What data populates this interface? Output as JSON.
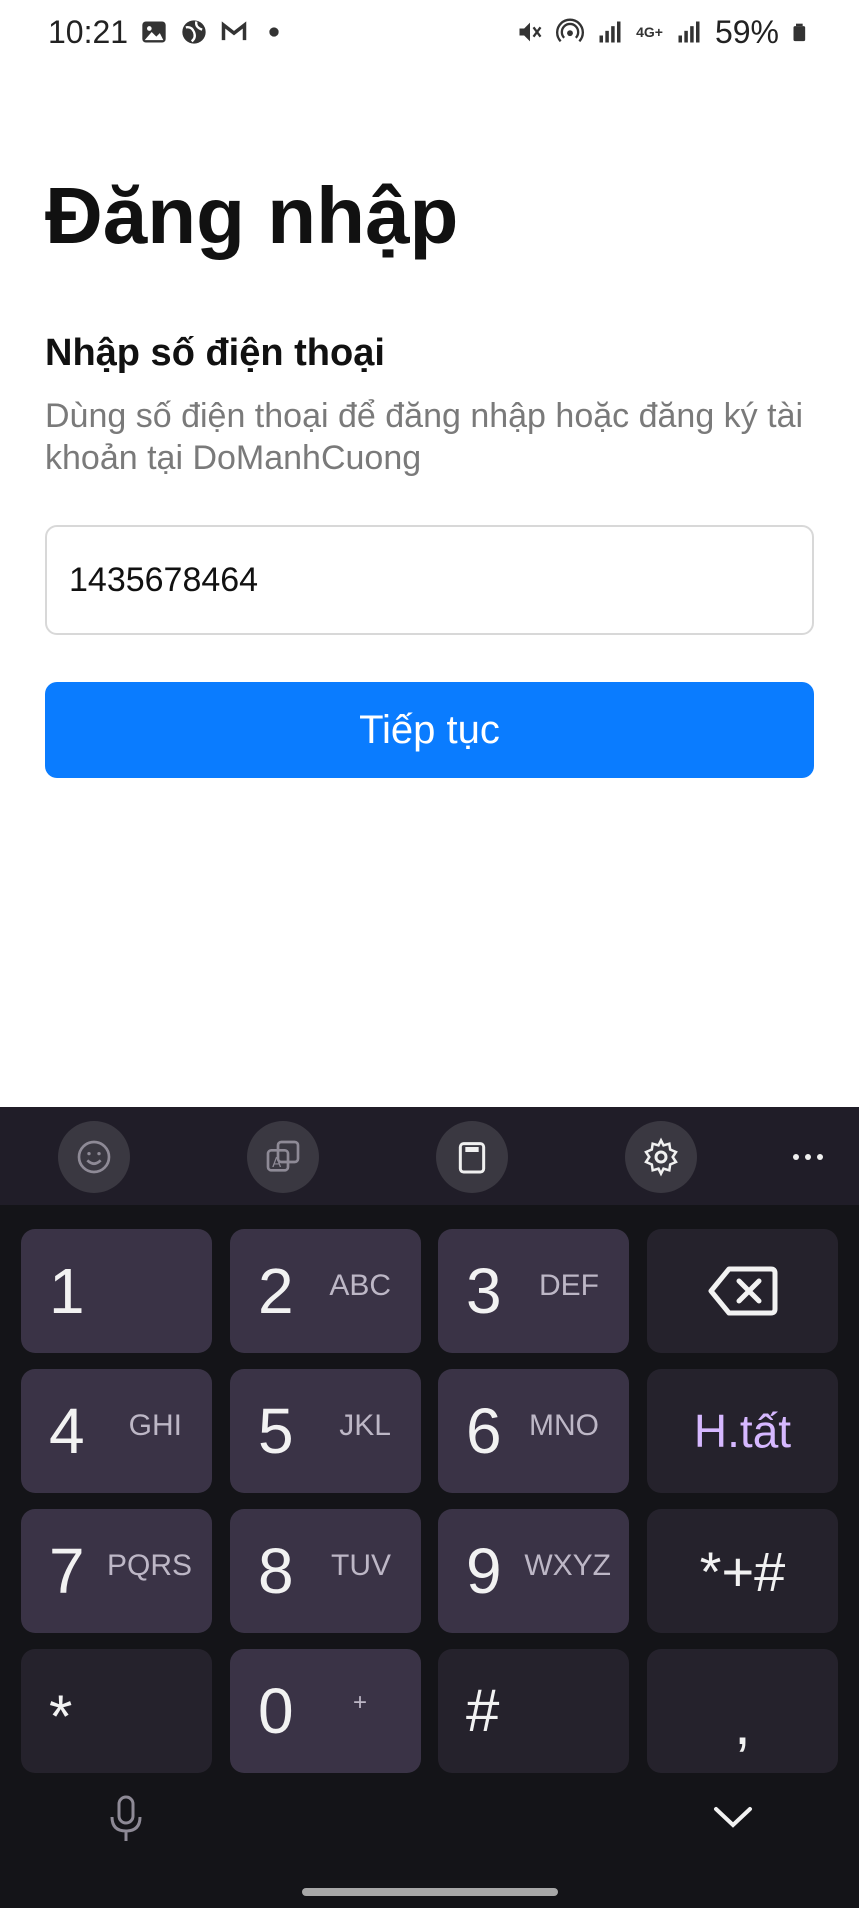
{
  "status_bar": {
    "time": "10:21",
    "battery": "59%",
    "network": "4G+"
  },
  "login": {
    "title": "Đăng nhập",
    "section_title": "Nhập số điện thoại",
    "description": "Dùng số điện thoại để đăng nhập hoặc đăng ký tài khoản tại DoManhCuong",
    "phone_value": "1435678464",
    "continue_label": "Tiếp tục",
    "accent_color": "#0a7cff"
  },
  "keyboard": {
    "toolbar_icons": [
      "emoji-icon",
      "translate-icon",
      "clipboard-icon",
      "gear-icon",
      "more-icon"
    ],
    "keys": {
      "k1": {
        "num": "1",
        "letters": ""
      },
      "k2": {
        "num": "2",
        "letters": "ABC"
      },
      "k3": {
        "num": "3",
        "letters": "DEF"
      },
      "k4": {
        "num": "4",
        "letters": "GHI"
      },
      "k5": {
        "num": "5",
        "letters": "JKL"
      },
      "k6": {
        "num": "6",
        "letters": "MNO"
      },
      "k7": {
        "num": "7",
        "letters": "PQRS"
      },
      "k8": {
        "num": "8",
        "letters": "TUV"
      },
      "k9": {
        "num": "9",
        "letters": "WXYZ"
      },
      "k0": {
        "num": "0",
        "letters": "+"
      },
      "done": "H.tất",
      "symbols": "*+#",
      "star": "*",
      "hash": "#",
      "comma": ","
    }
  }
}
